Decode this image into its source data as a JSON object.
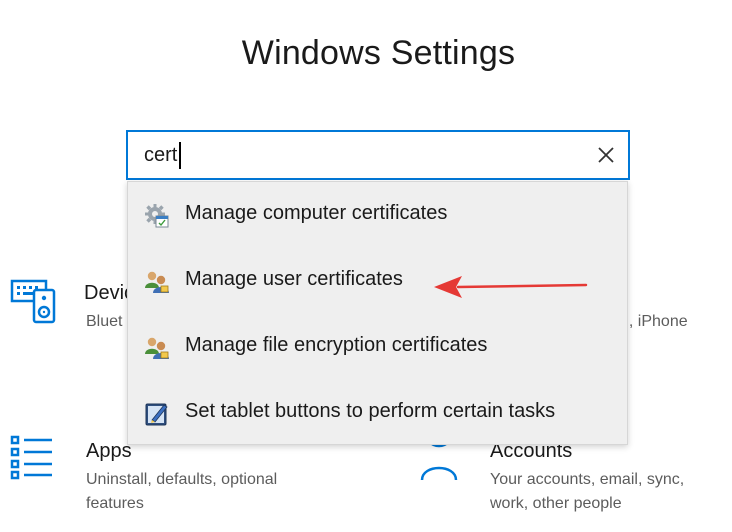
{
  "window": {
    "title": "Windows Settings"
  },
  "search": {
    "value": "cert",
    "placeholder": "",
    "clear_icon": "close-icon"
  },
  "suggestions": [
    {
      "label": "Manage computer certificates",
      "icon": "certificate-gear-icon"
    },
    {
      "label": "Manage user certificates",
      "icon": "users-icon"
    },
    {
      "label": "Manage file encryption certificates",
      "icon": "users-icon"
    },
    {
      "label": "Set tablet buttons to perform certain tasks",
      "icon": "tablet-pen-icon"
    }
  ],
  "tiles": {
    "devices": {
      "name": "Devic",
      "desc": "Bluet",
      "icon": "keyboard-speaker-icon"
    },
    "phone": {
      "desc": "d, iPhone"
    },
    "apps": {
      "name": "Apps",
      "desc": "Uninstall, defaults, optional features",
      "icon": "apps-list-icon"
    },
    "accounts": {
      "name": "Accounts",
      "desc": "Your accounts, email, sync, work, other people",
      "icon": "person-icon"
    }
  },
  "colors": {
    "accent": "#0078d7",
    "annotation_arrow": "#e53935",
    "dropdown_bg": "#efefef"
  }
}
